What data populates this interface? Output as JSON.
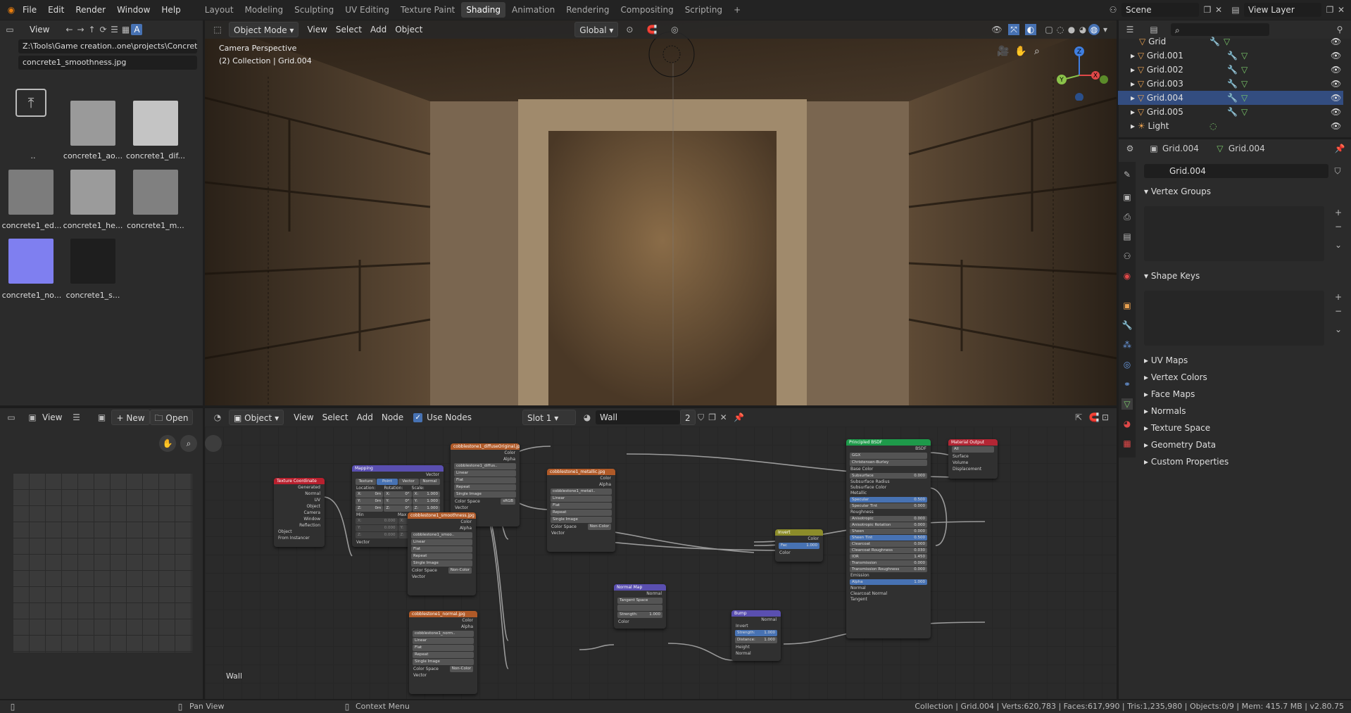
{
  "topbar": {
    "menus": [
      "File",
      "Edit",
      "Render",
      "Window",
      "Help"
    ],
    "workspaces": [
      "Layout",
      "Modeling",
      "Sculpting",
      "UV Editing",
      "Texture Paint",
      "Shading",
      "Animation",
      "Rendering",
      "Compositing",
      "Scripting"
    ],
    "active_workspace": "Shading",
    "add_tab": "+",
    "scene": "Scene",
    "view_layer": "View Layer"
  },
  "file_browser": {
    "view_label": "View",
    "path": "Z:\\Tools\\Game creation..one\\projects\\Concrete1\\",
    "filename": "concrete1_smoothness.jpg",
    "parent_label": "..",
    "files": [
      {
        "label": "concrete1_ao..."
      },
      {
        "label": "concrete1_dif..."
      },
      {
        "label": "concrete1_ed..."
      },
      {
        "label": "concrete1_he..."
      },
      {
        "label": "concrete1_m..."
      },
      {
        "label": "concrete1_no..."
      },
      {
        "label": "concrete1_s..."
      }
    ]
  },
  "viewport": {
    "mode": "Object Mode",
    "menus": [
      "View",
      "Select",
      "Add",
      "Object"
    ],
    "orientation": "Global",
    "camera_label": "Camera Perspective",
    "collection_label": "(2) Collection | Grid.004",
    "axes": {
      "x": "X",
      "y": "Y",
      "z": "Z"
    }
  },
  "outliner": {
    "items": [
      {
        "name": "Grid"
      },
      {
        "name": "Grid.001"
      },
      {
        "name": "Grid.002"
      },
      {
        "name": "Grid.003"
      },
      {
        "name": "Grid.004"
      },
      {
        "name": "Grid.005"
      },
      {
        "name": "Light"
      }
    ],
    "selected": "Grid.004"
  },
  "properties": {
    "breadcrumb_object": "Grid.004",
    "breadcrumb_data": "Grid.004",
    "data_name": "Grid.004",
    "sections": [
      "Vertex Groups",
      "Shape Keys",
      "UV Maps",
      "Vertex Colors",
      "Face Maps",
      "Normals",
      "Texture Space",
      "Geometry Data",
      "Custom Properties"
    ]
  },
  "image_editor": {
    "view_label": "View",
    "new_label": "New",
    "open_label": "Open"
  },
  "node_editor": {
    "object_label": "Object",
    "menus": [
      "View",
      "Select",
      "Add",
      "Node"
    ],
    "use_nodes": "Use Nodes",
    "slot": "Slot 1",
    "material": "Wall",
    "users": "2",
    "footer_label": "Wall",
    "nodes": {
      "texcoord": {
        "title": "Texture Coordinate",
        "outputs": [
          "Generated",
          "Normal",
          "UV",
          "Object",
          "Camera",
          "Window",
          "Reflection"
        ],
        "object_label": "Object",
        "from_instancer": "From Instancer"
      },
      "mapping": {
        "title": "Mapping",
        "output": "Vector",
        "types": [
          "Texture",
          "Point",
          "Vector",
          "Normal"
        ],
        "cols": [
          "Location:",
          "Rotation:",
          "Scale:"
        ],
        "rows": [
          [
            "X:",
            "0m",
            "X:",
            "0°",
            "X:",
            "1.000"
          ],
          [
            "Y:",
            "0m",
            "Y:",
            "0°",
            "Y:",
            "1.000"
          ],
          [
            "Z:",
            "0m",
            "Z:",
            "0°",
            "Z:",
            "1.000"
          ]
        ],
        "min": "Min",
        "max": "Max",
        "minmax": [
          [
            "X:",
            "0.000",
            "X:",
            "1.000"
          ],
          [
            "Y:",
            "0.000",
            "Y:",
            "1.000"
          ],
          [
            "Z:",
            "0.000",
            "Z:",
            "1.000"
          ]
        ],
        "input": "Vector"
      },
      "diffuse": {
        "title": "cobblestone1_diffuseOriginal.jpg",
        "img": "cobblestone1_diffus..",
        "colorspace": "sRGB"
      },
      "metallic": {
        "title": "cobblestone1_metallic.jpg",
        "img": "cobblestone1_metall..",
        "colorspace": "Non-Color"
      },
      "smooth": {
        "title": "cobblestone1_smoothness.jpg",
        "img": "cobblestone1_smoo..",
        "colorspace": "Non-Color"
      },
      "normal_tex": {
        "title": "cobblestone1_normal.jpg",
        "img": "cobblestone1_norm..",
        "colorspace": "Non-Color"
      },
      "normalmap": {
        "title": "Normal Map",
        "output": "Normal",
        "space": "Tangent Space",
        "strength_label": "Strength:",
        "strength": "1.000",
        "input": "Color"
      },
      "bump": {
        "title": "Bump",
        "output": "Normal",
        "invert": "Invert",
        "strength_label": "Strength:",
        "strength": "1.000",
        "distance_label": "Distance:",
        "distance": "1.000",
        "inputs": [
          "Height",
          "Normal"
        ]
      },
      "invert": {
        "title": "Invert",
        "output": "Color",
        "fac": "Fac",
        "fac_val": "1.000",
        "input": "Color"
      },
      "bsdf": {
        "title": "Principled BSDF",
        "output": "BSDF",
        "dist": "GGX",
        "sss": "Christensen-Burley",
        "rows": [
          [
            "Base Color",
            ""
          ],
          [
            "Subsurface",
            "0.000"
          ],
          [
            "Subsurface Radius",
            ""
          ],
          [
            "Subsurface Color",
            ""
          ],
          [
            "Metallic",
            ""
          ],
          [
            "Specular",
            "0.500"
          ],
          [
            "Specular Tint",
            "0.000"
          ],
          [
            "Roughness",
            ""
          ],
          [
            "Anisotropic",
            "0.000"
          ],
          [
            "Anisotropic Rotation",
            "0.000"
          ],
          [
            "Sheen",
            "0.000"
          ],
          [
            "Sheen Tint",
            "0.500"
          ],
          [
            "Clearcoat",
            "0.000"
          ],
          [
            "Clearcoat Roughness",
            "0.030"
          ],
          [
            "IOR",
            "1.450"
          ],
          [
            "Transmission",
            "0.000"
          ],
          [
            "Transmission Roughness",
            "0.000"
          ],
          [
            "Emission",
            ""
          ],
          [
            "Alpha",
            "1.000"
          ],
          [
            "Normal",
            ""
          ],
          [
            "Clearcoat Normal",
            ""
          ],
          [
            "Tangent",
            ""
          ]
        ]
      },
      "output": {
        "title": "Material Output",
        "target": "All",
        "inputs": [
          "Surface",
          "Volume",
          "Displacement"
        ]
      }
    },
    "common": {
      "color": "Color",
      "alpha": "Alpha",
      "vector": "Vector",
      "linear": "Linear",
      "flat": "Flat",
      "repeat": "Repeat",
      "single": "Single Image",
      "cs_label": "Color Space"
    }
  },
  "statusbar": {
    "pan": "Pan View",
    "context": "Context Menu",
    "stats": "Collection | Grid.004 | Verts:620,783 | Faces:617,990 | Tris:1,235,980 | Objects:0/9 | Mem: 415.7 MB | v2.80.75"
  },
  "colors": {
    "accent": "#4772b3",
    "selected_row": "#334d80",
    "image_node": "#b05a28",
    "shader_node": "#1e9a4a",
    "output_node": "#b32634",
    "vector_node": "#5a4fb0",
    "input_node": "#b8202e",
    "color_node": "#8c8c2a"
  }
}
